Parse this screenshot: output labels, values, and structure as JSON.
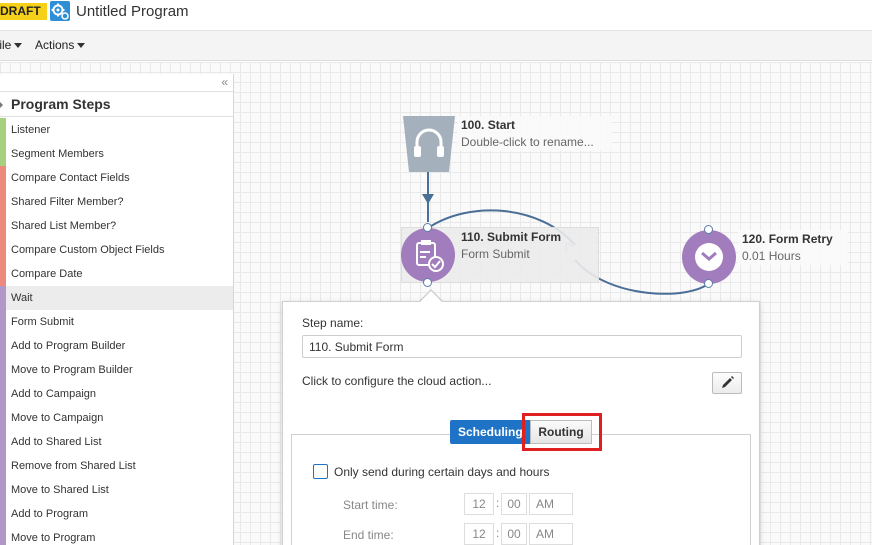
{
  "header": {
    "badge": "DRAFT",
    "title": "Untitled Program"
  },
  "menu": {
    "file_label": "File",
    "actions_label": "Actions"
  },
  "sidebar": {
    "collapse_label": "«",
    "title": "Program Steps",
    "items": [
      {
        "label": "Listener",
        "color": "#a6cf7e"
      },
      {
        "label": "Segment Members",
        "color": "#a6cf7e"
      },
      {
        "label": "Compare Contact Fields",
        "color": "#ee8a7d"
      },
      {
        "label": "Shared Filter Member?",
        "color": "#ee8a7d"
      },
      {
        "label": "Shared List Member?",
        "color": "#ee8a7d"
      },
      {
        "label": "Compare Custom Object Fields",
        "color": "#ee8a7d"
      },
      {
        "label": "Compare Date",
        "color": "#ee8a7d"
      },
      {
        "label": "Wait",
        "color": "#b197c8"
      },
      {
        "label": "Form Submit",
        "color": "#b197c8"
      },
      {
        "label": "Add to Program Builder",
        "color": "#b197c8"
      },
      {
        "label": "Move to Program Builder",
        "color": "#b197c8"
      },
      {
        "label": "Add to Campaign",
        "color": "#b197c8"
      },
      {
        "label": "Move to Campaign",
        "color": "#b197c8"
      },
      {
        "label": "Add to Shared List",
        "color": "#b197c8"
      },
      {
        "label": "Remove from Shared List",
        "color": "#b197c8"
      },
      {
        "label": "Move to Shared List",
        "color": "#b197c8"
      },
      {
        "label": "Add to Program",
        "color": "#b197c8"
      },
      {
        "label": "Move to Program",
        "color": "#b197c8"
      }
    ]
  },
  "nodes": {
    "start": {
      "title": "100. Start",
      "subtitle": "Double-click to rename..."
    },
    "submit": {
      "title": "110. Submit Form",
      "subtitle": "Form Submit"
    },
    "retry": {
      "title": "120. Form Retry",
      "subtitle": "0.01 Hours"
    }
  },
  "popover": {
    "step_name_label": "Step name:",
    "step_name_value": "110. Submit Form",
    "configure_text": "Click to configure the cloud action...",
    "tab_scheduling": "Scheduling",
    "tab_routing": "Routing",
    "checkbox_label": "Only send during certain days and hours",
    "start_time_label": "Start time:",
    "end_time_label": "End time:",
    "start_hour": "12",
    "start_minute": "00",
    "start_ampm": "AM",
    "end_hour": "12",
    "end_minute": "00",
    "end_ampm": "AM"
  },
  "colors": {
    "accent": "#1e73c6",
    "draft": "#f7d119",
    "node_purple": "#a17dbd",
    "node_gray": "#a4b1bc",
    "connector": "#4a6f96",
    "highlight": "#e02020"
  }
}
